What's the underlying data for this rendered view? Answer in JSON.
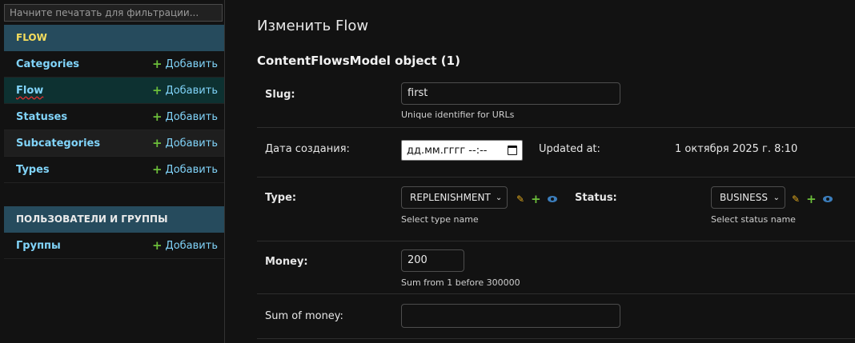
{
  "sidebar": {
    "filter_placeholder": "Начните печатать для фильтрации...",
    "modules": [
      {
        "title": "FLOW",
        "items": [
          {
            "label": "Categories",
            "add": "Добавить"
          },
          {
            "label": "Flow",
            "add": "Добавить"
          },
          {
            "label": "Statuses",
            "add": "Добавить"
          },
          {
            "label": "Subcategories",
            "add": "Добавить"
          },
          {
            "label": "Types",
            "add": "Добавить"
          }
        ]
      },
      {
        "title": "ПОЛЬЗОВАТЕЛИ И ГРУППЫ",
        "items": [
          {
            "label": "Группы",
            "add": "Добавить"
          }
        ]
      }
    ]
  },
  "main": {
    "page_title": "Изменить Flow",
    "object_title": "ContentFlowsModel object (1)",
    "slug": {
      "label": "Slug:",
      "value": "first",
      "help": "Unique identifier for URLs"
    },
    "created": {
      "label": "Дата создания:",
      "value": "дд.мм.гггг --:--",
      "updated_label": "Updated at:",
      "updated_value": "1 октября 2025 г. 8:10"
    },
    "type": {
      "label": "Type:",
      "value": "REPLENISHMENT",
      "help": "Select type name"
    },
    "status": {
      "label": "Status:",
      "value": "BUSINESS",
      "help": "Select status name"
    },
    "money": {
      "label": "Money:",
      "value": "200",
      "help": "Sum from 1 before 300000"
    },
    "sum_of_money": {
      "label": "Sum of money:",
      "value": ""
    }
  },
  "icons": {
    "add": "plus-icon",
    "edit": "pencil-icon",
    "view": "eye-icon",
    "calendar": "calendar-icon"
  },
  "colors": {
    "accent_yellow": "#f5dd5d",
    "link_blue": "#81d4fa",
    "module_header": "#264b5d",
    "add_green": "#6cbe3a"
  }
}
